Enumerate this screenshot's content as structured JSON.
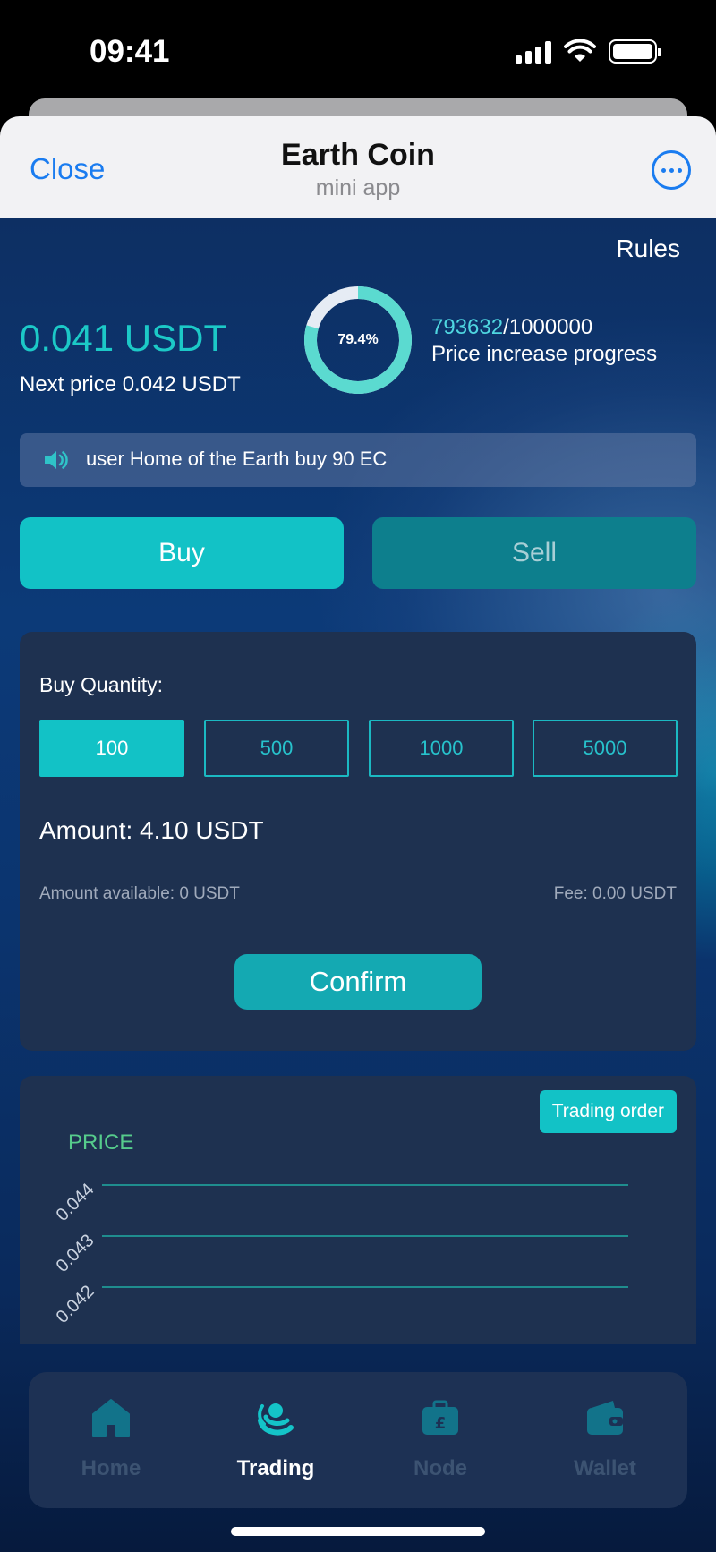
{
  "status_bar": {
    "time": "09:41"
  },
  "header": {
    "close_label": "Close",
    "title": "Earth Coin",
    "subtitle": "mini app",
    "more_icon": "more-icon"
  },
  "main": {
    "rules_label": "Rules",
    "price": "0.041 USDT",
    "next_price": "Next price 0.042 USDT",
    "progress": {
      "percent_label": "79.4%",
      "fraction": 0.794,
      "current": "793632",
      "total": "/1000000",
      "label": "Price increase progress"
    },
    "ticker": {
      "icon": "speaker-icon",
      "text": "user Home of the Earth buy 90 EC"
    },
    "buy_label": "Buy",
    "sell_label": "Sell"
  },
  "buy_card": {
    "quantity_label": "Buy Quantity:",
    "quantity_options": [
      "100",
      "500",
      "1000",
      "5000"
    ],
    "selected_quantity": "100",
    "amount": "Amount: 4.10 USDT",
    "available": "Amount available: 0 USDT",
    "fee": "Fee: 0.00 USDT",
    "confirm_label": "Confirm"
  },
  "chart_card": {
    "trading_order_label": "Trading order",
    "chart_data": {
      "type": "line",
      "title": "PRICE",
      "y_ticks": [
        "0.044",
        "0.043",
        "0.042"
      ],
      "series": []
    }
  },
  "nav": {
    "items": [
      {
        "label": "Home",
        "icon": "home-icon",
        "active": false
      },
      {
        "label": "Trading",
        "icon": "trading-icon",
        "active": true
      },
      {
        "label": "Node",
        "icon": "node-icon",
        "active": false
      },
      {
        "label": "Wallet",
        "icon": "wallet-icon",
        "active": false
      }
    ]
  },
  "colors": {
    "accent": "#12c2c6",
    "card": "#1e3150",
    "ios_blue": "#1a7cf0"
  }
}
